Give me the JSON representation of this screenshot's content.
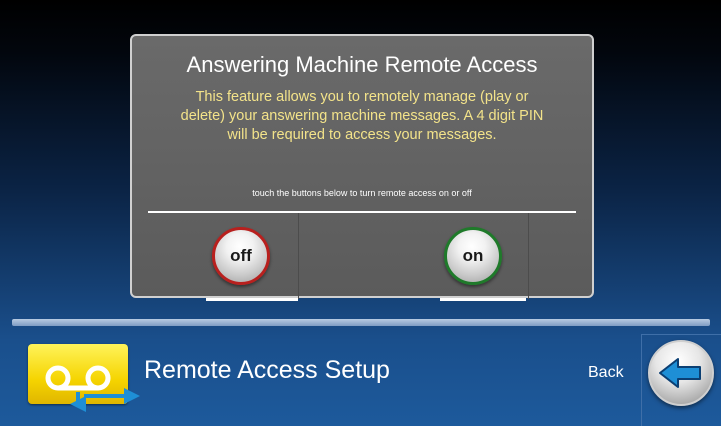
{
  "dialog": {
    "title": "Answering Machine Remote Access",
    "description": "This feature allows you to remotely manage (play or delete) your answering machine messages. A 4 digit PIN will be required to access your messages.",
    "hint": "touch the buttons below to turn remote access on or off",
    "off_label": "off",
    "on_label": "on"
  },
  "footer": {
    "title": "Remote Access Setup",
    "back_label": "Back",
    "app_icon": "voicemail-remote-icon",
    "back_icon": "arrow-left-icon"
  },
  "colors": {
    "description_text": "#f3e38a",
    "off_ring": "#b8201e",
    "on_ring": "#1f7a2a",
    "arrow": "#1e8fd6",
    "icon_yellow": "#f5d400"
  }
}
